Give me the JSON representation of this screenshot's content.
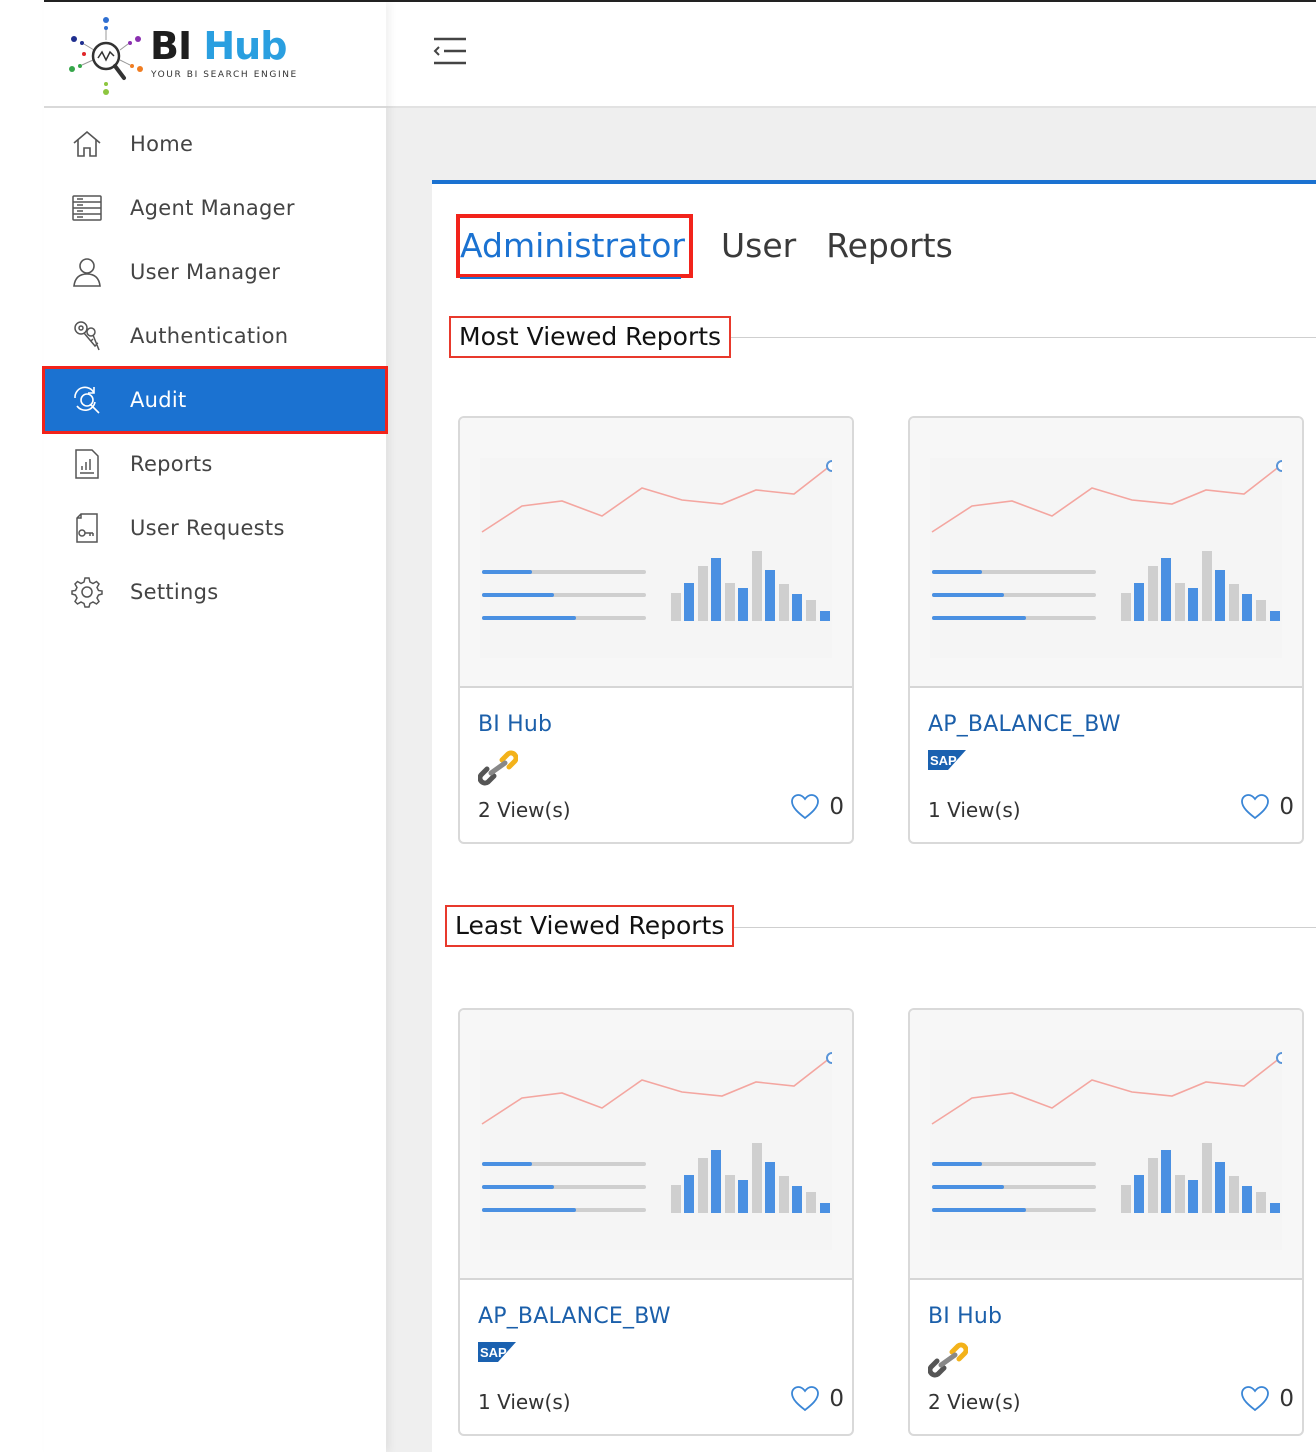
{
  "brand": {
    "name_part1": "BI",
    "name_part2": "Hub",
    "tagline": "YOUR BI SEARCH ENGINE"
  },
  "sidebar": {
    "items": [
      {
        "label": "Home",
        "icon": "home-icon"
      },
      {
        "label": "Agent Manager",
        "icon": "server-icon"
      },
      {
        "label": "User Manager",
        "icon": "user-icon"
      },
      {
        "label": "Authentication",
        "icon": "keys-icon"
      },
      {
        "label": "Audit",
        "icon": "audit-search-icon",
        "active": true
      },
      {
        "label": "Reports",
        "icon": "report-chart-icon"
      },
      {
        "label": "User Requests",
        "icon": "request-doc-icon"
      },
      {
        "label": "Settings",
        "icon": "gear-icon"
      }
    ]
  },
  "tabs": [
    {
      "label": "Administrator",
      "active": true
    },
    {
      "label": "User"
    },
    {
      "label": "Reports"
    }
  ],
  "sections": {
    "most_viewed": {
      "title": "Most Viewed Reports",
      "cards": [
        {
          "title": "BI Hub",
          "source": "link-icon",
          "views": "2 View(s)",
          "likes": "0"
        },
        {
          "title": "AP_BALANCE_BW",
          "source": "sap-logo",
          "views": "1 View(s)",
          "likes": "0"
        }
      ]
    },
    "least_viewed": {
      "title": "Least Viewed Reports",
      "cards": [
        {
          "title": "AP_BALANCE_BW",
          "source": "sap-logo",
          "views": "1 View(s)",
          "likes": "0"
        },
        {
          "title": "BI Hub",
          "source": "link-icon",
          "views": "2 View(s)",
          "likes": "0"
        }
      ]
    }
  },
  "colors": {
    "accent": "#1b72d1",
    "highlight": "#f2231b",
    "title_link": "#1b5faa"
  }
}
